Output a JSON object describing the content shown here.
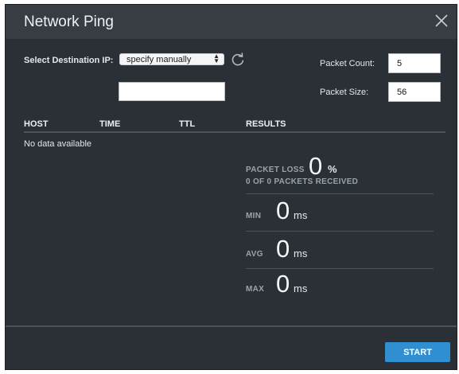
{
  "window": {
    "title": "Network Ping",
    "close_icon": "close-icon"
  },
  "form": {
    "dest_label": "Select Destination IP:",
    "dest_select_value": "specify manually",
    "refresh_icon": "refresh-icon",
    "manual_ip_value": "",
    "packet_count_label": "Packet Count:",
    "packet_count_value": "5",
    "packet_size_label": "Packet Size:",
    "packet_size_value": "56"
  },
  "table": {
    "columns": [
      "HOST",
      "TIME",
      "TTL",
      "RESULTS"
    ],
    "empty_text": "No data available"
  },
  "results": {
    "packet_loss_label": "PACKET LOSS",
    "packet_loss_value": "0",
    "packet_loss_unit": "%",
    "received_text": "0 OF 0 PACKETS RECEIVED",
    "min_label": "MIN",
    "min_value": "0",
    "avg_label": "AVG",
    "avg_value": "0",
    "max_label": "MAX",
    "max_value": "0",
    "unit_ms": "ms"
  },
  "footer": {
    "start_label": "START"
  },
  "colors": {
    "dialog_bg": "#2b3037",
    "titlebar_bg": "#383d44",
    "accent": "#2f8fd1"
  }
}
